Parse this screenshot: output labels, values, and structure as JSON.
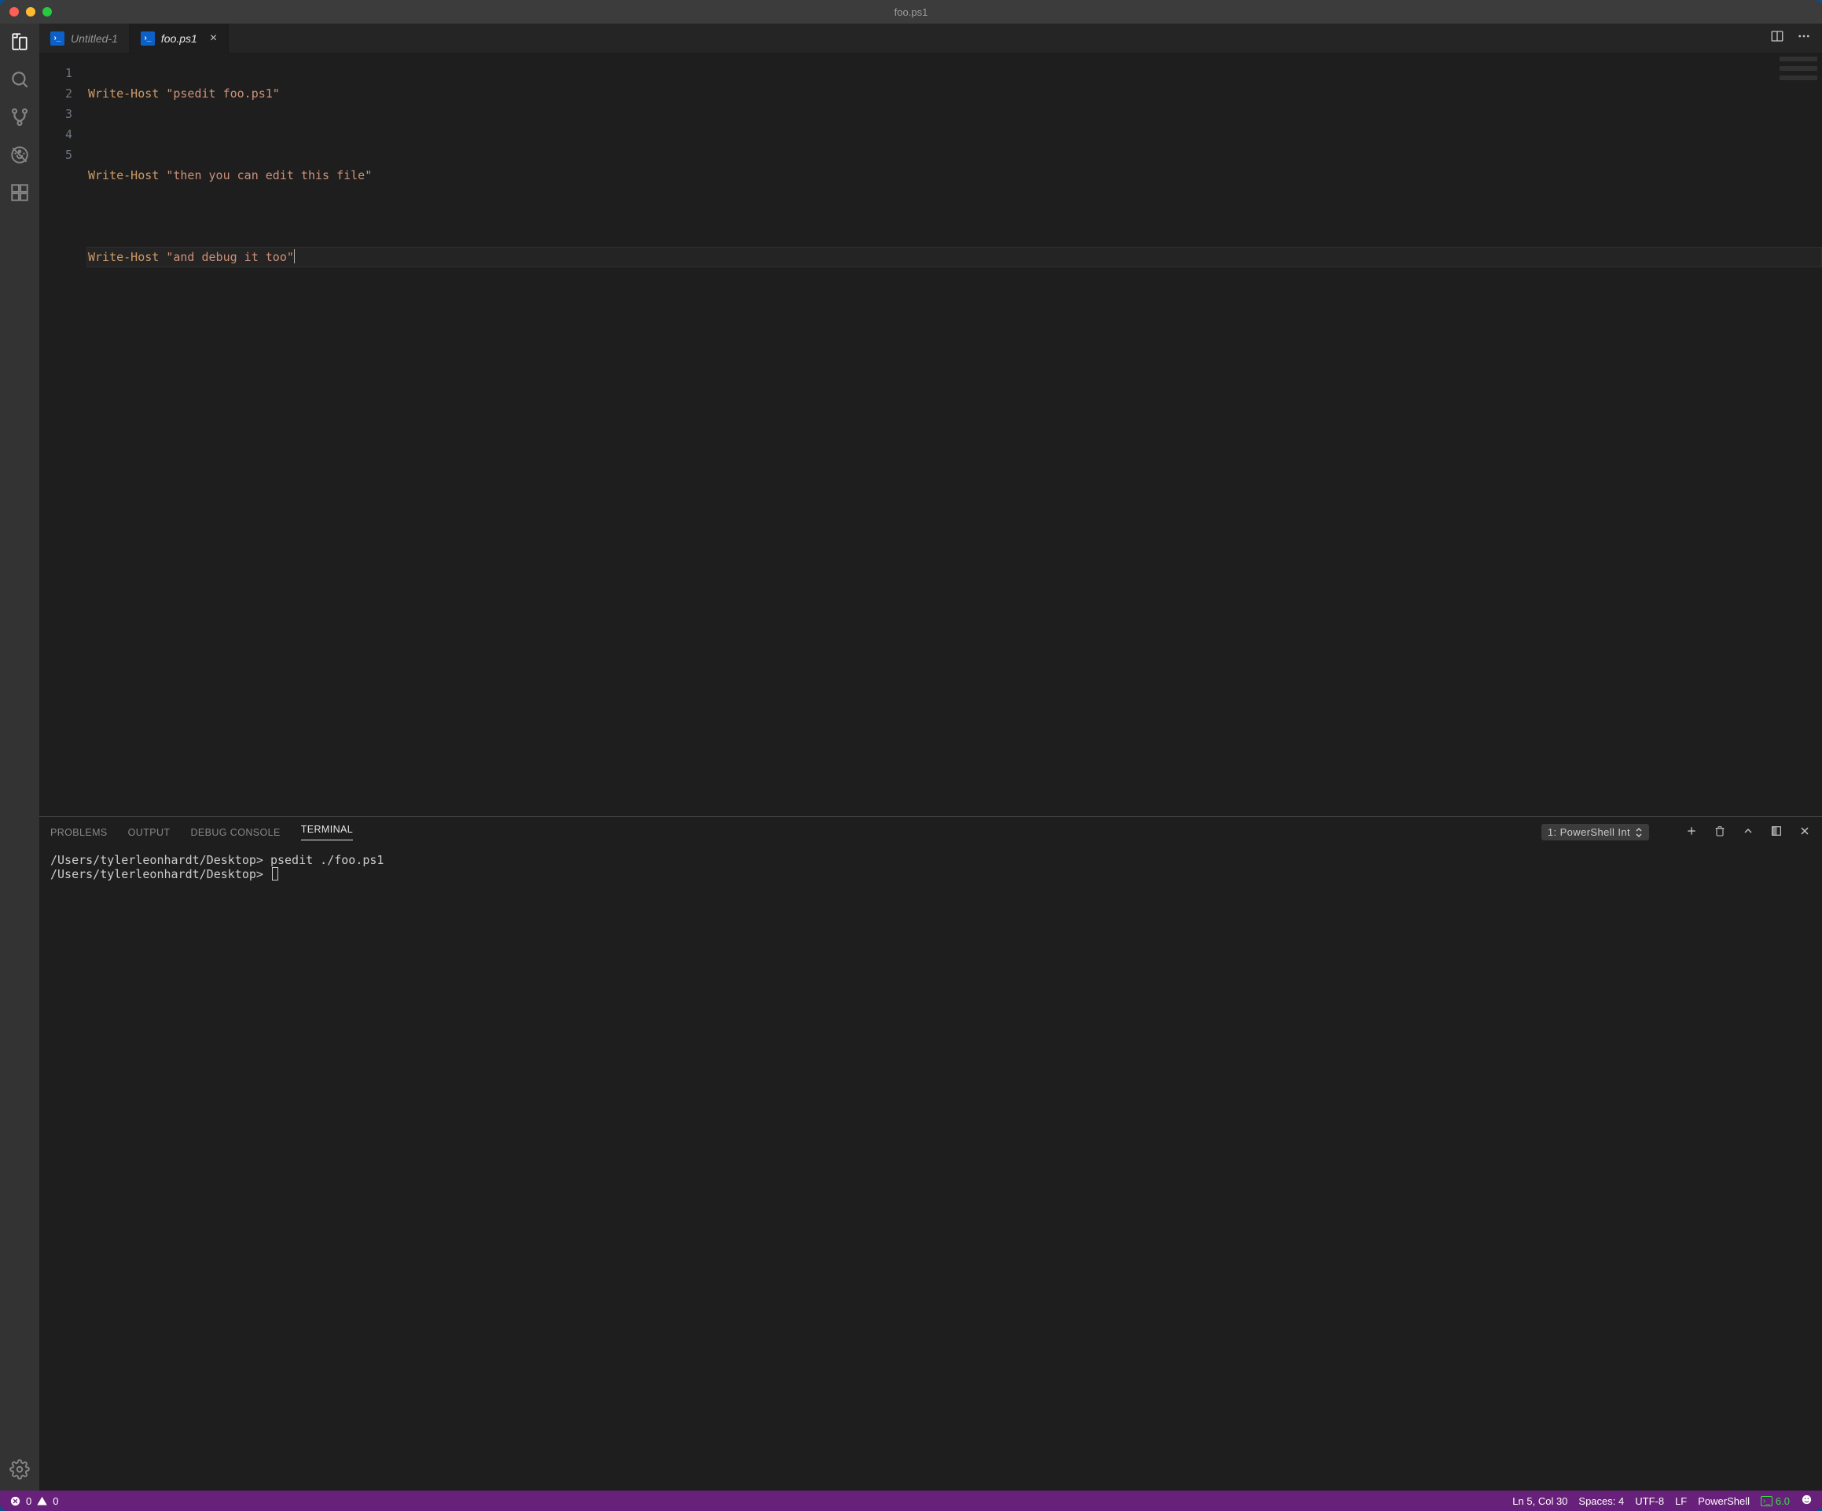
{
  "titlebar": {
    "title": "foo.ps1"
  },
  "tabs": [
    {
      "label": "Untitled-1"
    },
    {
      "label": "foo.ps1"
    }
  ],
  "editor": {
    "line_numbers": [
      "1",
      "2",
      "3",
      "4",
      "5"
    ],
    "lines": [
      {
        "cmd": "Write-Host",
        "str": "\"psedit foo.ps1\"",
        "blank": false
      },
      {
        "blank": true
      },
      {
        "cmd": "Write-Host",
        "str": "\"then you can edit this file\"",
        "blank": false
      },
      {
        "blank": true
      },
      {
        "cmd": "Write-Host",
        "str": "\"and debug it too\"",
        "blank": false,
        "hl": true
      }
    ]
  },
  "panel": {
    "tabs": {
      "problems": "PROBLEMS",
      "output": "OUTPUT",
      "debug": "DEBUG CONSOLE",
      "terminal": "TERMINAL"
    },
    "terminal_select": "1: PowerShell Int",
    "terminal_lines": [
      "/Users/tylerleonhardt/Desktop> psedit ./foo.ps1",
      "/Users/tylerleonhardt/Desktop> "
    ]
  },
  "status": {
    "errors": "0",
    "warnings": "0",
    "cursor": "Ln 5, Col 30",
    "spaces": "Spaces: 4",
    "encoding": "UTF-8",
    "eol": "LF",
    "language": "PowerShell",
    "ps_version": "6.0"
  }
}
